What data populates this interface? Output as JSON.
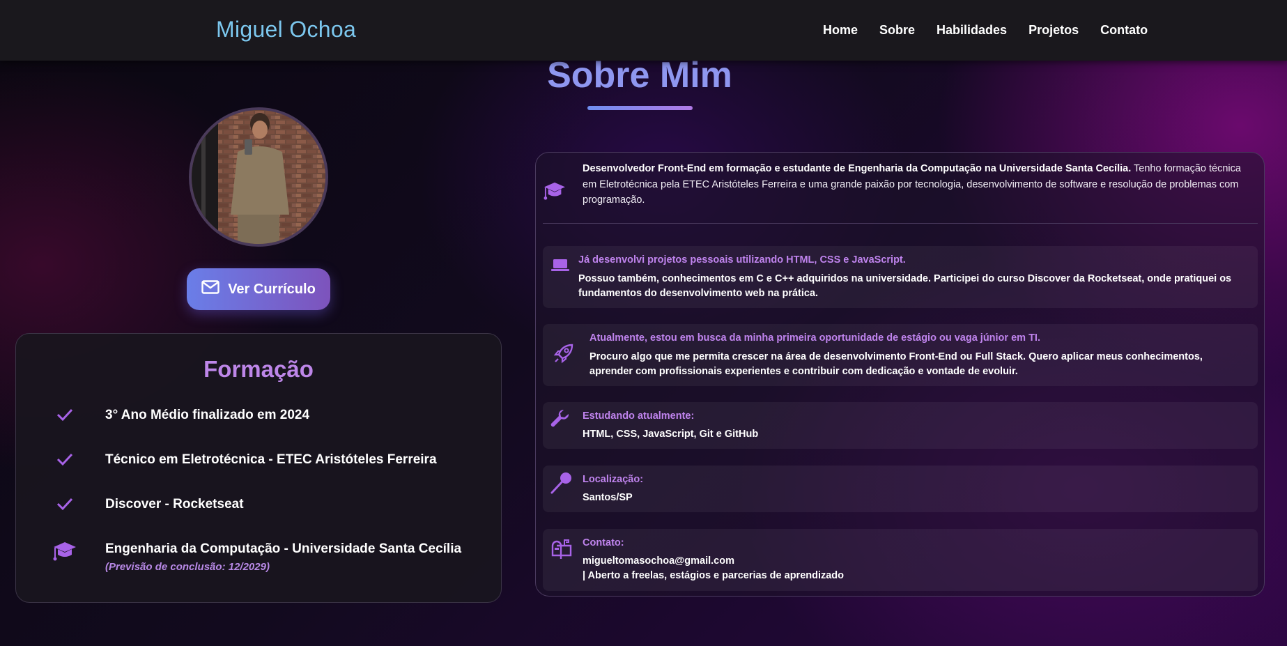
{
  "header": {
    "brand": "Miguel Ochoa",
    "nav": [
      "Home",
      "Sobre",
      "Habilidades",
      "Projetos",
      "Contato"
    ]
  },
  "section": {
    "title": "Sobre Mim"
  },
  "profile": {
    "cv_button": "Ver Currículo",
    "cv_icon": "mail-icon"
  },
  "formacao": {
    "title": "Formação",
    "items": [
      {
        "icon": "check-icon",
        "text": "3° Ano Médio finalizado em 2024"
      },
      {
        "icon": "check-icon",
        "text": "Técnico em Eletrotécnica - ETEC Aristóteles Ferreira"
      },
      {
        "icon": "check-icon",
        "text": "Discover - Rocketseat"
      },
      {
        "icon": "graduation-cap-icon",
        "text": "Engenharia da Computação - Universidade Santa Cecília",
        "note": "(Previsão de conclusão: 12/2029)"
      }
    ]
  },
  "about": {
    "intro_bold": "Desenvolvedor Front-End em formação e estudante de Engenharia da Computação na Universidade Santa Cecília.",
    "intro_rest": " Tenho formação técnica em Eletrotécnica pela ETEC Aristóteles Ferreira e uma grande paixão por tecnologia, desenvolvimento de software e resolução de problemas com programação.",
    "blocks": [
      {
        "icon": "laptop-icon",
        "heading": "Já desenvolvi projetos pessoais utilizando HTML, CSS e JavaScript.",
        "body": "Possuo também, conhecimentos em C e C++ adquiridos na universidade. Participei do curso Discover da Rocketseat, onde pratiquei os fundamentos do desenvolvimento web na prática."
      },
      {
        "icon": "rocket-icon",
        "heading": "Atualmente, estou em busca da minha primeira oportunidade de estágio ou vaga júnior em TI.",
        "body": "Procuro algo que me permita crescer na área de desenvolvimento Front-End ou Full Stack. Quero aplicar meus conhecimentos, aprender com profissionais experientes e contribuir com dedicação e vontade de evoluir."
      },
      {
        "icon": "wrench-icon",
        "heading": "Estudando atualmente:",
        "body": "HTML, CSS, JavaScript, Git e GitHub"
      },
      {
        "icon": "map-pin-icon",
        "heading": "Localização:",
        "body": "Santos/SP"
      },
      {
        "icon": "mailbox-icon",
        "heading": "Contato:",
        "body": "migueltomasochoa@gmail.com",
        "body2": "| Aberto a freelas, estágios e parcerias de aprendizado"
      }
    ]
  },
  "colors": {
    "accent": "#bd86e8",
    "brand": "#7cc7ee",
    "title": "#8f97f0"
  }
}
